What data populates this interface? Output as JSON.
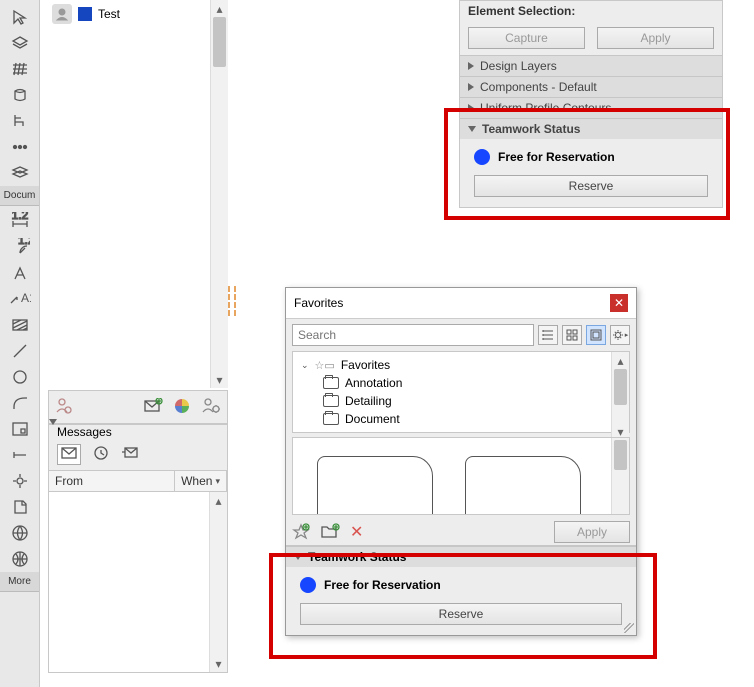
{
  "toolbar_labels": {
    "documents": "Docum",
    "more": "More"
  },
  "user_list": {
    "items": [
      {
        "name": "Test",
        "color": "#1646bf"
      }
    ]
  },
  "messages_panel": {
    "title": "Messages",
    "columns": {
      "from": "From",
      "when": "When"
    }
  },
  "right_panel": {
    "element_selection_label": "Element Selection:",
    "capture_btn": "Capture",
    "apply_btn": "Apply",
    "sections": {
      "design_layers": "Design Layers",
      "components_default": "Components - Default",
      "uniform_profile": "Uniform Profile Contours",
      "teamwork_status": "Teamwork Status"
    },
    "status_text": "Free for Reservation",
    "reserve_btn": "Reserve"
  },
  "favorites": {
    "title": "Favorites",
    "search_placeholder": "Search",
    "tree": {
      "root": "Favorites",
      "items": [
        "Annotation",
        "Detailing",
        "Document"
      ]
    },
    "apply_btn": "Apply",
    "teamwork_status": "Teamwork Status",
    "status_text": "Free for Reservation",
    "reserve_btn": "Reserve"
  }
}
